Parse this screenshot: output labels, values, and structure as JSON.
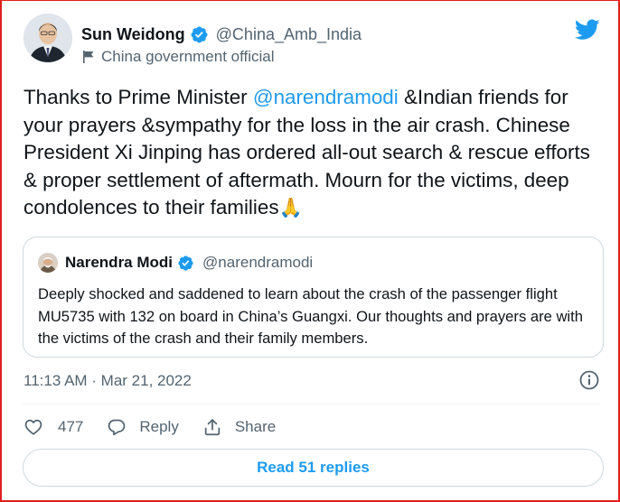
{
  "author": {
    "name": "Sun Weidong",
    "handle": "@China_Amb_India",
    "label": "China government official",
    "verified": true
  },
  "tweet": {
    "segments": [
      "Thanks to Prime Minister ",
      "@narendramodi",
      " &Indian friends for your prayers &sympathy for the loss in the air crash. Chinese President Xi Jinping has ordered all-out search & rescue efforts & proper settlement of aftermath. Mourn for the victims, deep condolences to their families",
      "🙏"
    ]
  },
  "quoted_tweet": {
    "name": "Narendra Modi",
    "handle": "@narendramodi",
    "verified": true,
    "text": "Deeply shocked and saddened to learn about the crash of the passenger flight MU5735 with 132 on board in China’s Guangxi. Our thoughts and prayers are with the victims of the crash and their family members."
  },
  "timestamp": "11:13 AM · Mar 21, 2022",
  "actions": {
    "like_count": "477",
    "reply_label": "Reply",
    "share_label": "Share"
  },
  "read_replies_label": "Read 51 replies",
  "icons": {
    "brand": "twitter-bird-icon",
    "verified": "verified-badge-icon",
    "label": "government-flag-icon",
    "info": "info-icon",
    "like": "heart-icon",
    "reply": "reply-bubble-icon",
    "share": "share-upload-icon"
  },
  "colors": {
    "accent": "#1d9bf0",
    "text_primary": "#0f1419",
    "text_secondary": "#536471",
    "border": "#cfd9de",
    "frame_border": "#e0201e"
  }
}
